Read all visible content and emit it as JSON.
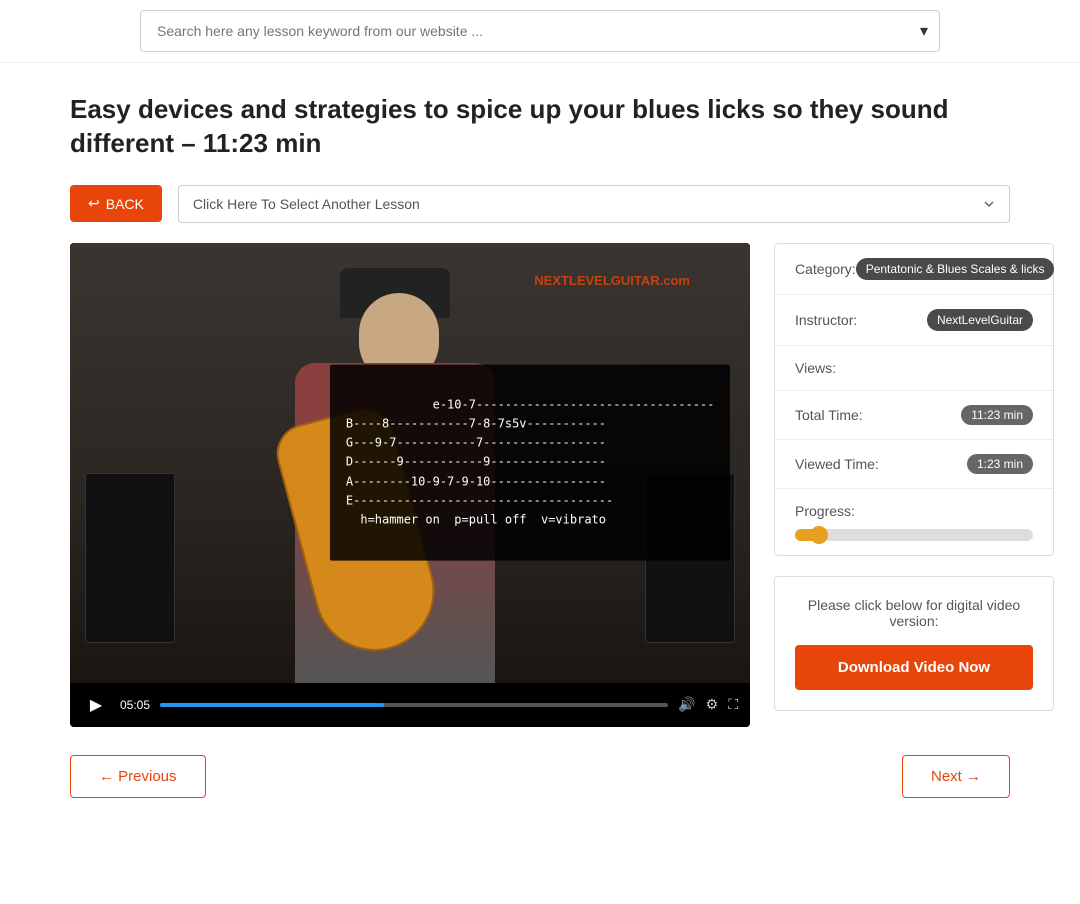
{
  "header": {
    "search_placeholder": "Search here any lesson keyword from our website ..."
  },
  "lesson": {
    "title": "Easy devices and strategies to spice up your blues licks so they sound different – 11:23 min",
    "back_label": "BACK",
    "select_placeholder": "Click Here To Select Another Lesson"
  },
  "video": {
    "current_time": "05:05",
    "tab_content": "e-10-7---------------------------------\nB----8-----------7-8-7s5v-----------\nG---9-7-----------7-----------------\nD------9-----------9----------------\nA--------10-9-7-9-10----------------\nE------------------------------------\n  h=hammer on  p=pull off  v=vibrato",
    "logo_text": "NEXTLEVELGUITAR.com"
  },
  "sidebar": {
    "category_label": "Category:",
    "category_value": "Pentatonic & Blues Scales & licks",
    "instructor_label": "Instructor:",
    "instructor_value": "NextLevelGuitar",
    "views_label": "Views:",
    "views_value": "",
    "total_time_label": "Total Time:",
    "total_time_value": "11:23 min",
    "viewed_time_label": "Viewed Time:",
    "viewed_time_value": "1:23 min",
    "progress_label": "Progress:",
    "progress_percent": 12,
    "download_text": "Please click below for digital video version:",
    "download_button_label": "Download Video Now"
  },
  "navigation": {
    "previous_label": "← Previous",
    "next_label": "Next →"
  }
}
